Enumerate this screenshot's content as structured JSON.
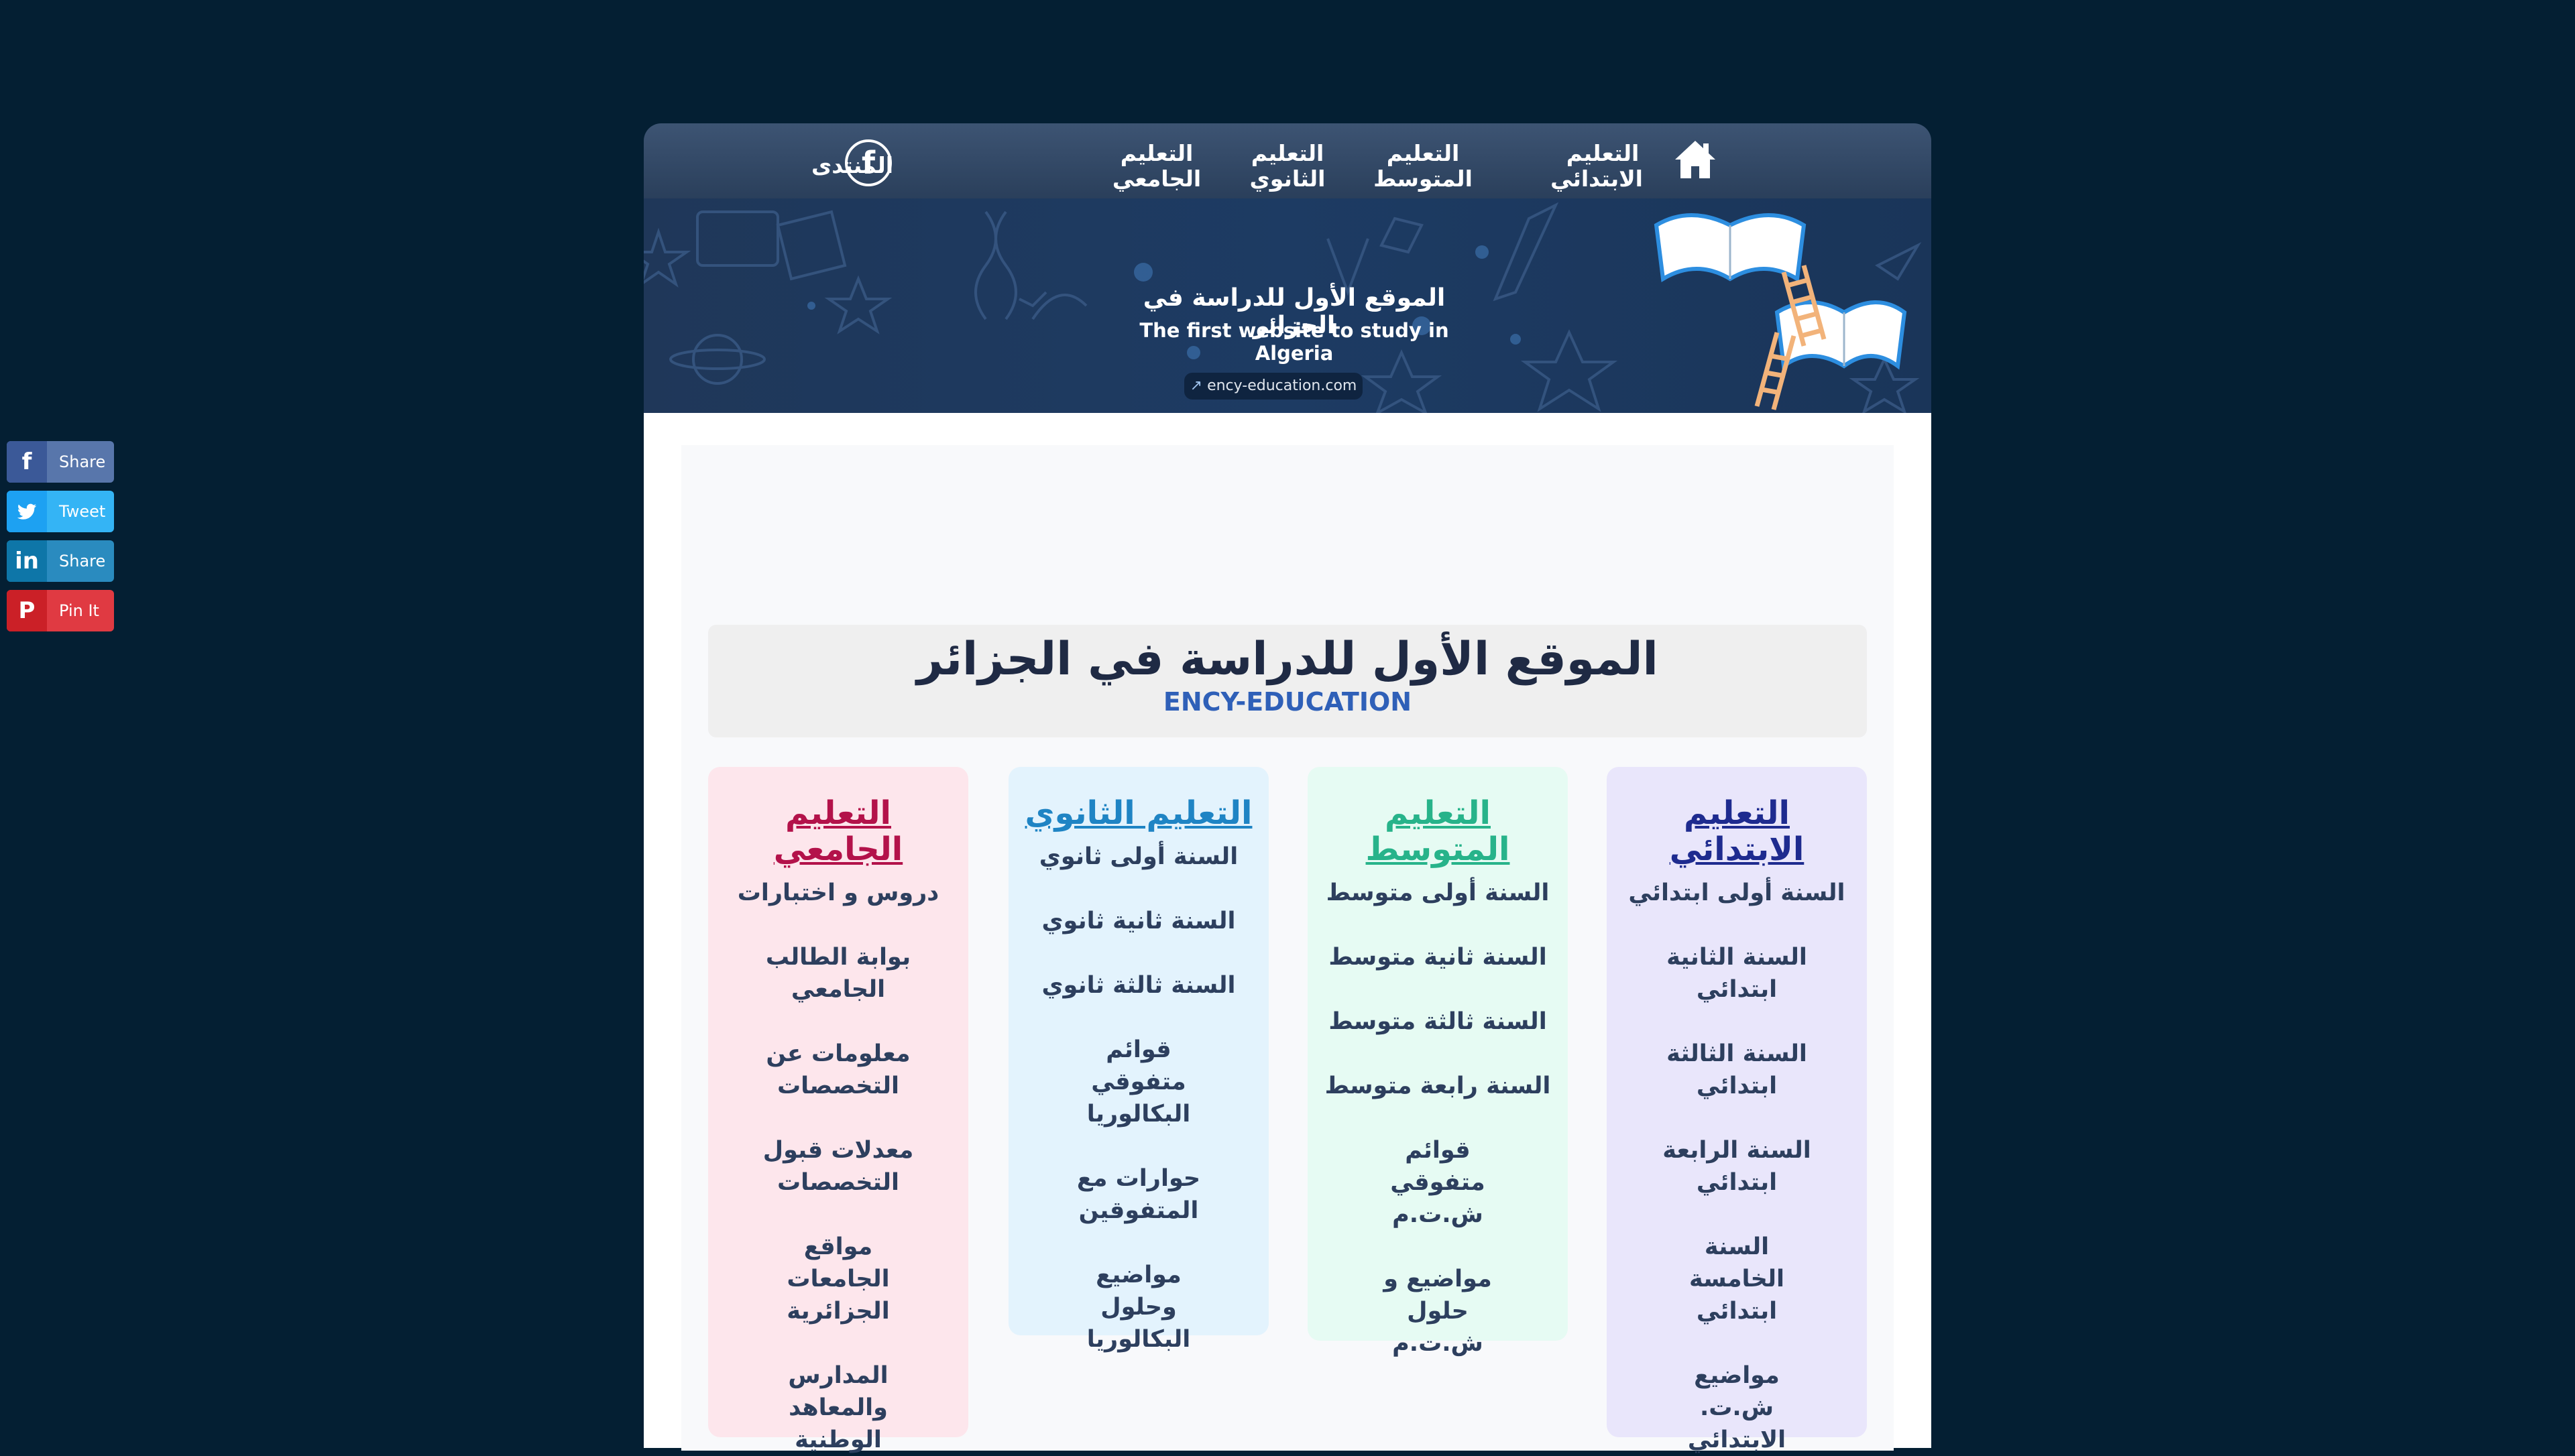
{
  "nav": {
    "items": [
      {
        "line1": "التعليم",
        "line2": "الابتدائي"
      },
      {
        "line1": "التعليم",
        "line2": "المتوسط"
      },
      {
        "line1": "التعليم",
        "line2": "الثانوي"
      },
      {
        "line1": "التعليم",
        "line2": "الجامعي"
      },
      {
        "line1": "المنتدى",
        "line2": ""
      }
    ],
    "home_icon": "home-icon",
    "social_icon": "facebook-icon"
  },
  "banner": {
    "title_ar": "الموقع الأول للدراسة في الجزائر",
    "title_en": "The first website to study in Algeria",
    "url": "ency-education.com"
  },
  "header": {
    "title": "الموقع الأول للدراسة في الجزائر",
    "subtitle": "ENCY-EDUCATION"
  },
  "columns": {
    "primary": {
      "title": "التعليم الابتدائي",
      "color": "#1e2b8f",
      "bg": "#e9e6fb",
      "links": [
        "السنة أولى ابتدائي",
        "السنة الثانية ابتدائي",
        "السنة الثالثة ابتدائي",
        "السنة الرابعة ابتدائي",
        "السنة الخامسة ابتدائي",
        "مواضيع ش.ت. الابتدائي"
      ]
    },
    "middle": {
      "title": "التعليم المتوسط",
      "color": "#27b38a",
      "bg": "#e6fbf3",
      "links": [
        "السنة أولى متوسط",
        "السنة ثانية متوسط",
        "السنة ثالثة متوسط",
        "السنة رابعة متوسط",
        "قوائم متفوقي ش.ت.م",
        "مواضيع و حلول ش.ت.م"
      ]
    },
    "secondary": {
      "title": "التعليم الثانوي",
      "color": "#1f84c4",
      "bg": "#e3f3fd",
      "links": [
        "السنة أولى ثانوي",
        "السنة ثانية ثانوي",
        "السنة ثالثة ثانوي",
        "قوائم متفوقي البكالوريا",
        "حوارات  مع المتفوقين",
        "مواضيع وحلول البكالوريا"
      ]
    },
    "university": {
      "title": "التعليم الجامعي",
      "color": "#b3124a",
      "bg": "#fde6ec",
      "links": [
        "دروس و اختبارات",
        "بوابة الطالب الجامعي",
        "معلومات عن التخصصات",
        "معدلات قبول التخصصات",
        "مواقع الجامعات الجزائرية",
        "المدارس والمعاهد الوطنية"
      ]
    }
  },
  "share": [
    {
      "label": "Share",
      "icon": "facebook-icon",
      "color": "#3b5998"
    },
    {
      "label": "Tweet",
      "icon": "twitter-icon",
      "color": "#1da1f2"
    },
    {
      "label": "Share",
      "icon": "linkedin-icon",
      "color": "#0e76a8"
    },
    {
      "label": "Pin It",
      "icon": "pinterest-icon",
      "color": "#cb2027"
    }
  ]
}
